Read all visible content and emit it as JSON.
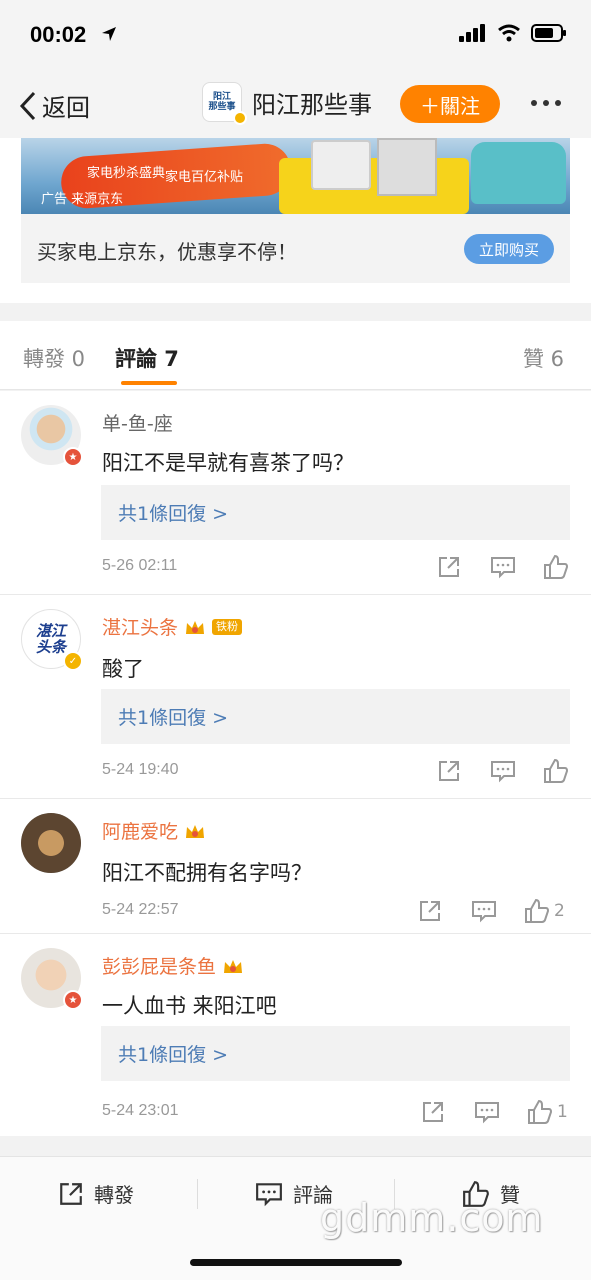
{
  "status_bar": {
    "time": "00:02"
  },
  "nav": {
    "back_label": "返回",
    "account_avatar_text": "阳江\n那些事",
    "title": "阳江那些事",
    "follow_label": "＋關注"
  },
  "ad": {
    "promo_1": "家电秒杀盛典",
    "promo_2": "家电百亿补贴",
    "source": "广告 来源京东",
    "text": "买家电上京东，优惠享不停！",
    "buy_label": "立即购买"
  },
  "tabs": [
    {
      "label": "轉發 0"
    },
    {
      "label": "評論 7"
    },
    {
      "label": "贊 6"
    }
  ],
  "comments": [
    {
      "user": "单-鱼-座",
      "text": "阳江不是早就有喜茶了吗？",
      "reply": "共1條回復 >",
      "time": "5-26 02:11",
      "likes": ""
    },
    {
      "user": "湛江头条",
      "fan_tag": "铁粉",
      "avatar_text": "湛江\n头条",
      "text": "酸了",
      "reply": "共1條回復 >",
      "time": "5-24 19:40",
      "likes": ""
    },
    {
      "user": "阿鹿爱吃",
      "text": "阳江不配拥有名字吗？",
      "time": "5-24 22:57",
      "likes": "2"
    },
    {
      "user": "彭彭屁是条鱼",
      "text": "一人血书 来阳江吧",
      "reply": "共1條回復 >",
      "time": "5-24 23:01",
      "likes": "1"
    }
  ],
  "bottom_bar": {
    "repost_label": "轉發",
    "comment_label": "評論",
    "like_label": "贊"
  },
  "watermark": "gdmm.com",
  "colors": {
    "accent": "#ff8200",
    "link": "#4d7cb5",
    "vip_name": "#eb7340",
    "buy_button": "#5b9de3"
  }
}
